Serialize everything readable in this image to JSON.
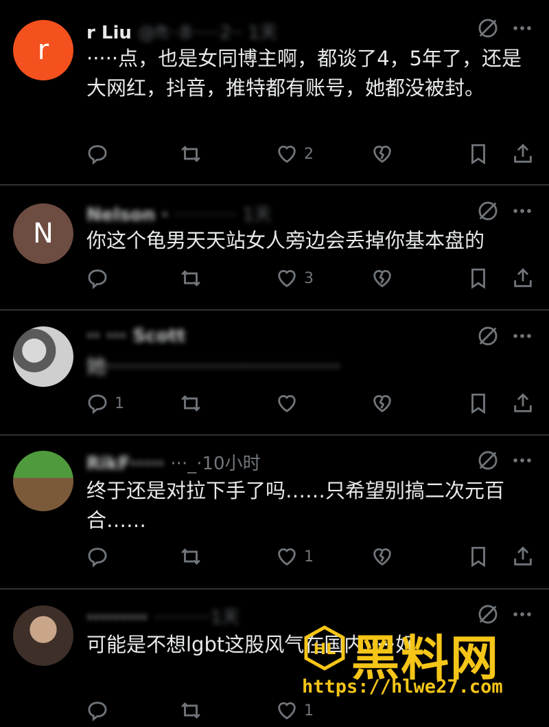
{
  "tweets": [
    {
      "avatar_letter": "r",
      "avatar_color": "#f4511e",
      "name": "r Liu",
      "handle_meta": "@ft··8·····2·· 1天",
      "text": "·····点，也是女同博主啊，都谈了4，5年了，还是大网红，抖音，推特都有账号，她都没被封。",
      "reply_count": "",
      "retweet_count": "",
      "like_count": "2"
    },
    {
      "avatar_letter": "N",
      "avatar_color": "#6d4c41",
      "name": "Nelson ·",
      "handle_meta": "··········· 1天",
      "text": "你这个龟男天天站女人旁边会丢掉你基本盘的",
      "reply_count": "",
      "retweet_count": "",
      "like_count": "3"
    },
    {
      "avatar_letter": "",
      "avatar_color": "#9e9e9e",
      "name": "·· ··· Scott",
      "handle_meta": "",
      "text": "她·····································",
      "reply_count": "1",
      "retweet_count": "",
      "like_count": ""
    },
    {
      "avatar_letter": "",
      "avatar_color": "#5d8a3a",
      "name": "RikF····· ",
      "handle_meta": "···_·10小时",
      "text": "终于还是对拉下手了吗……只希望别搞二次元百合……",
      "reply_count": "",
      "retweet_count": "",
      "like_count": "1"
    },
    {
      "avatar_letter": "",
      "avatar_color": "#8d6e63",
      "name": "·········",
      "handle_meta": "··········1天",
      "text": "可能是不想lgbt这股风气在国内·····好",
      "reply_count": "",
      "retweet_count": "",
      "like_count": "1"
    }
  ],
  "watermark": {
    "title": "黑料网",
    "url": "https://hlwe27.com",
    "color": "#f5c518"
  },
  "icons": {
    "reply": "reply-icon",
    "retweet": "retweet-icon",
    "like": "heart-icon",
    "dislike": "broken-heart-icon",
    "bookmark": "bookmark-icon",
    "share": "share-icon",
    "mute": "mute-icon",
    "more": "more-icon"
  }
}
